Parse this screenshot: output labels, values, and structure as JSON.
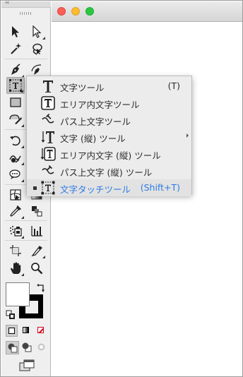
{
  "tools": [
    {
      "id": "selection",
      "icon": "selection-arrow-icon"
    },
    {
      "id": "direct-selection",
      "icon": "direct-selection-arrow-icon"
    },
    {
      "id": "magic-wand",
      "icon": "magic-wand-icon"
    },
    {
      "id": "lasso",
      "icon": "lasso-icon"
    },
    {
      "id": "pen",
      "icon": "pen-icon"
    },
    {
      "id": "curvature",
      "icon": "curvature-pen-icon"
    },
    {
      "id": "type",
      "icon": "type-tool-icon",
      "selected": true
    },
    {
      "id": "rectangle",
      "icon": "rectangle-icon"
    },
    {
      "id": "shaper",
      "icon": "shaper-icon"
    },
    {
      "id": "rotate",
      "icon": "rotate-icon"
    },
    {
      "id": "warp",
      "icon": "warp-icon"
    },
    {
      "id": "symbol-sprayer",
      "icon": "symbol-sprayer-icon"
    },
    {
      "id": "mesh",
      "icon": "mesh-icon"
    },
    {
      "id": "eyedropper",
      "icon": "eyedropper-icon"
    },
    {
      "id": "blend",
      "icon": "blend-icon"
    },
    {
      "id": "column-graph",
      "icon": "column-graph-icon"
    },
    {
      "id": "artboard",
      "icon": "artboard-icon"
    },
    {
      "id": "slice",
      "icon": "slice-icon"
    },
    {
      "id": "hand",
      "icon": "hand-icon"
    },
    {
      "id": "zoom",
      "icon": "zoom-icon"
    }
  ],
  "colors": {
    "fill": "#ffffff",
    "stroke": "#000000",
    "active_text": "#2c7be5",
    "none_swatch": "#d0021b"
  },
  "flyout": {
    "items": [
      {
        "label": "文字ツール",
        "shortcut": "(T)",
        "icon": "type-icon"
      },
      {
        "label": "エリア内文字ツール",
        "shortcut": "",
        "icon": "area-type-icon"
      },
      {
        "label": "パス上文字ツール",
        "shortcut": "",
        "icon": "type-on-path-icon"
      },
      {
        "label": "文字 (縦) ツール",
        "shortcut": "",
        "icon": "vertical-type-icon"
      },
      {
        "label": "エリア内文字 (縦) ツール",
        "shortcut": "",
        "icon": "vertical-area-type-icon"
      },
      {
        "label": "パス上文字 (縦) ツール",
        "shortcut": "",
        "icon": "vertical-type-on-path-icon"
      },
      {
        "label": "文字タッチツール",
        "shortcut": "(Shift+T)",
        "icon": "touch-type-icon",
        "checked": true
      }
    ]
  }
}
